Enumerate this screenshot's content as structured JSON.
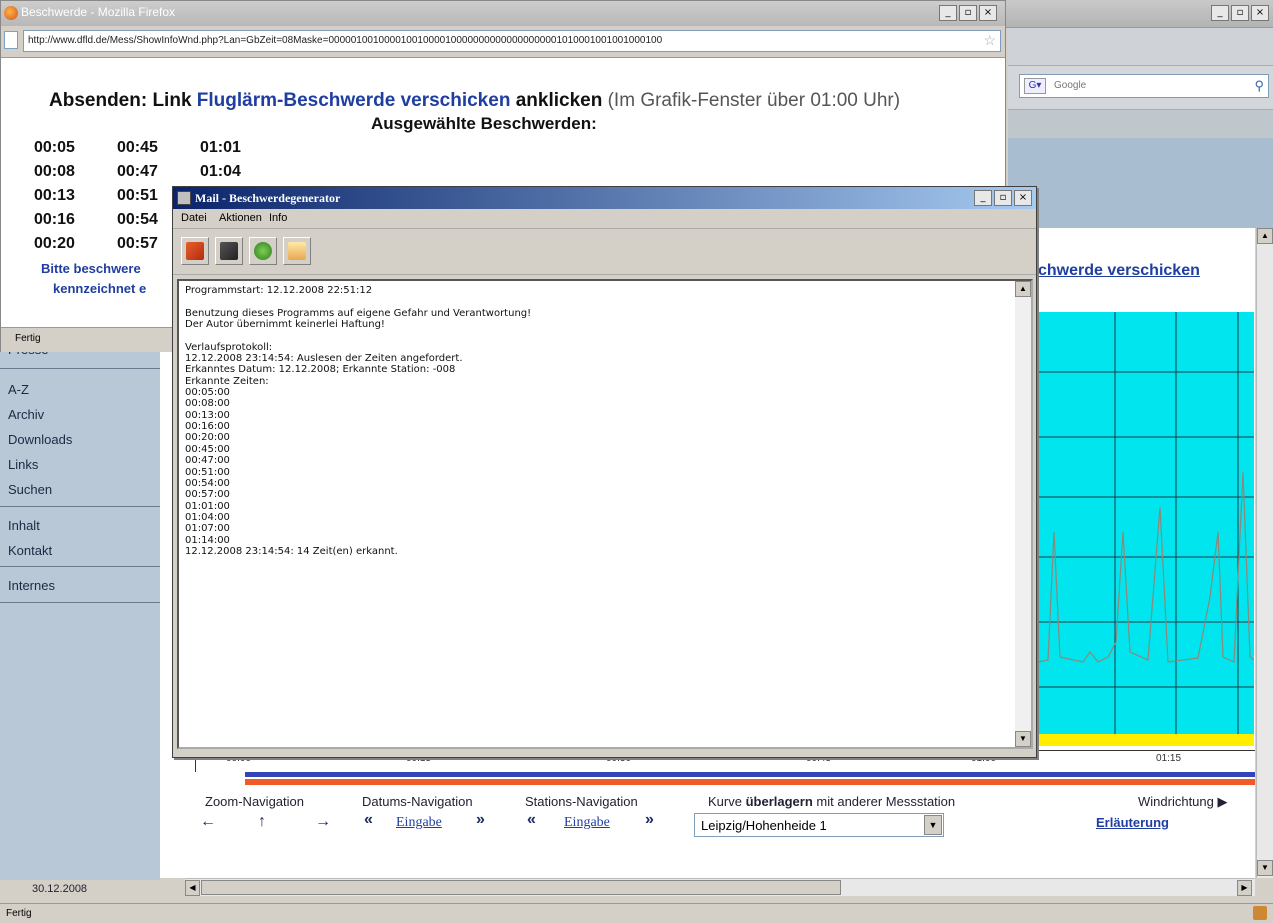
{
  "browser": {
    "search_placeholder": "Google",
    "status": "Fertig"
  },
  "page": {
    "sidebar": {
      "items": [
        "Presse",
        "A-Z",
        "Archiv",
        "Downloads",
        "Links",
        "Suchen",
        "Inhalt",
        "Kontakt",
        "Internes"
      ],
      "date": "30.12.2008"
    },
    "right_link": "chwerde verschicken",
    "axis_ticks": [
      "00:00",
      "00:15",
      "00:30",
      "00:45",
      "01:00",
      "01:15"
    ],
    "nav": {
      "zoom_label": "Zoom-Navigation",
      "date_label": "Datums-Navigation",
      "station_label": "Stations-Navigation",
      "overlay_label_pre": "Kurve",
      "overlay_label_bold": "überlagern",
      "overlay_label_post": "mit anderer Messstation",
      "wind_label": "Windrichtung ▶",
      "eingabe": "Eingabe",
      "station_value": "Leipzig/Hohenheide 1",
      "erlaeuterung": "Erläuterung",
      "arrow_left": "←",
      "arrow_up": "↑",
      "arrow_right": "→",
      "dbl_left": "«",
      "dbl_right": "»"
    }
  },
  "popup": {
    "title": "Beschwerde - Mozilla Firefox",
    "url": "http://www.dfld.de/Mess/ShowInfoWnd.php?Lan=GbZeit=08Maske=000001001000010010000100000000000000000001010001001001000100",
    "heading_pre": "Absenden: Link",
    "heading_link": "Fluglärm-Beschwerde verschicken",
    "heading_post": "anklicken",
    "heading_note": "(Im Grafik-Fenster über 01:00 Uhr)",
    "subheading": "Ausgewählte Beschwerden:",
    "times_col1": [
      "00:05",
      "00:08",
      "00:13",
      "00:16",
      "00:20"
    ],
    "times_col2": [
      "00:45",
      "00:47",
      "00:51",
      "00:54",
      "00:57"
    ],
    "times_col3": [
      "01:01",
      "01:04"
    ],
    "hint1": "Bitte beschwere",
    "hint2": "kennzeichnet e",
    "status": "Fertig"
  },
  "mail": {
    "title": "Mail - Beschwerdegenerator",
    "menu": [
      "Datei",
      "Aktionen",
      "Info"
    ],
    "log_lines": [
      "Programmstart: 12.12.2008 22:51:12",
      "",
      "Benutzung dieses Programms auf eigene Gefahr und Verantwortung!",
      "Der Autor übernimmt keinerlei Haftung!",
      "",
      "Verlaufsprotokoll:",
      "12.12.2008 23:14:54: Auslesen der Zeiten angefordert.",
      "Erkanntes Datum: 12.12.2008; Erkannte Station: -008",
      "Erkannte Zeiten:",
      "00:05:00",
      "00:08:00",
      "00:13:00",
      "00:16:00",
      "00:20:00",
      "00:45:00",
      "00:47:00",
      "00:51:00",
      "00:54:00",
      "00:57:00",
      "01:01:00",
      "01:04:00",
      "01:07:00",
      "01:14:00",
      "12.12.2008 23:14:54: 14 Zeit(en) erkannt."
    ]
  },
  "colors": {
    "chart_bg": "#00e5ee",
    "link_blue": "#1f3ea0",
    "mail_title_blue": "#0a246a"
  }
}
